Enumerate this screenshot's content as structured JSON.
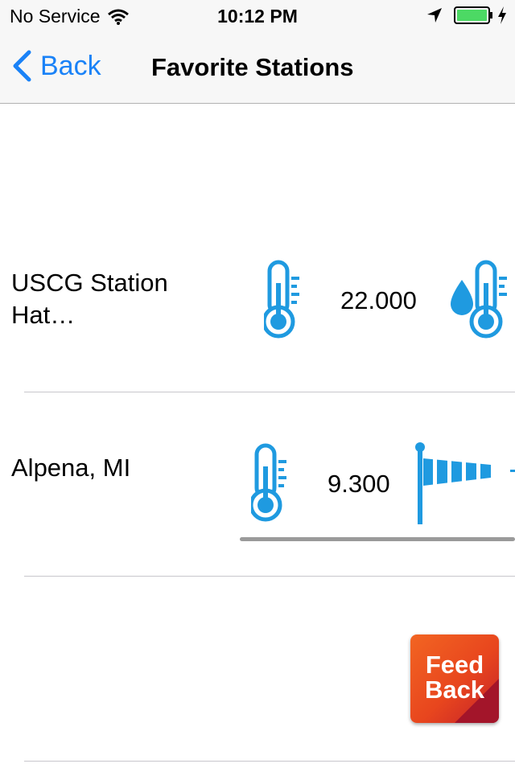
{
  "status_bar": {
    "carrier": "No Service",
    "time": "10:12 PM",
    "battery_color": "#4cd964"
  },
  "nav": {
    "back_label": "Back",
    "title": "Favorite Stations",
    "accent_color": "#1a82f7"
  },
  "stations": [
    {
      "name": "USCG Station Hat…",
      "icon_1": "thermometer-icon",
      "value": "22.000",
      "icon_2": "water-temperature-icon"
    },
    {
      "name": "Alpena, MI",
      "icon_1": "thermometer-icon",
      "value": "9.300",
      "icon_2": "windsock-icon"
    }
  ],
  "feedback": {
    "line1": "Feed",
    "line2": "Back"
  },
  "icon_color": "#1f9ae0"
}
